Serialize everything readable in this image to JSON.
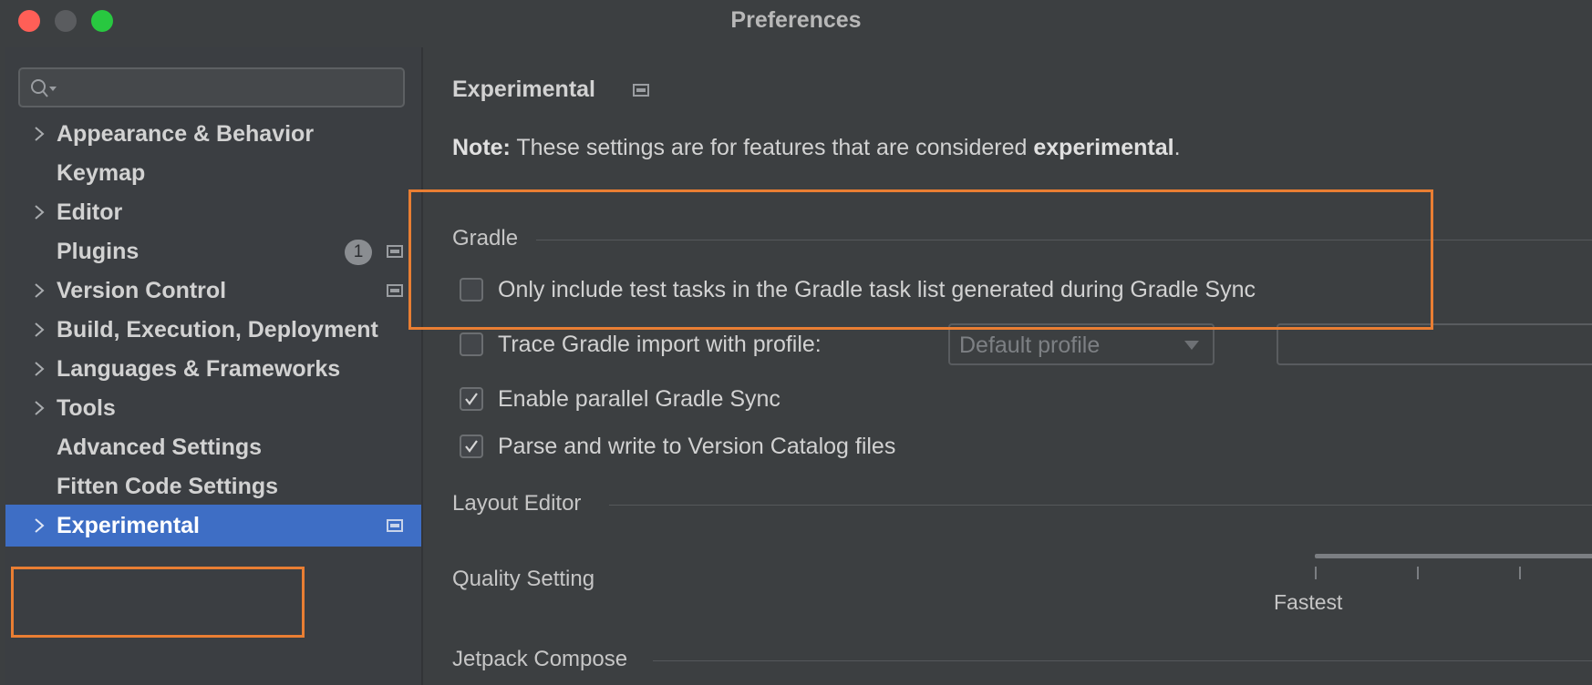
{
  "window": {
    "title": "Preferences"
  },
  "search": {
    "placeholder": ""
  },
  "sidebar": {
    "items": [
      {
        "label": "Appearance & Behavior",
        "expandable": true
      },
      {
        "label": "Keymap",
        "expandable": false
      },
      {
        "label": "Editor",
        "expandable": true
      },
      {
        "label": "Plugins",
        "expandable": false,
        "badge": "1"
      },
      {
        "label": "Version Control",
        "expandable": true
      },
      {
        "label": "Build, Execution, Deployment",
        "expandable": true
      },
      {
        "label": "Languages & Frameworks",
        "expandable": true
      },
      {
        "label": "Tools",
        "expandable": true
      },
      {
        "label": "Advanced Settings",
        "expandable": false
      },
      {
        "label": "Fitten Code Settings",
        "expandable": false
      },
      {
        "label": "Experimental",
        "expandable": true,
        "selected": true
      }
    ]
  },
  "main": {
    "title": "Experimental",
    "note_prefix": "Note:",
    "note_text": " These settings are for features that are considered ",
    "note_bold": "experimental",
    "note_suffix": ".",
    "gradle": {
      "header": "Gradle",
      "options": [
        {
          "label": "Only include test tasks in the Gradle task list generated during Gradle Sync",
          "checked": false
        },
        {
          "label": "Trace Gradle import with profile:",
          "checked": false
        },
        {
          "label": "Enable parallel Gradle Sync",
          "checked": true
        },
        {
          "label": "Parse and write to Version Catalog files",
          "checked": true
        }
      ],
      "profile_dropdown": {
        "value": "Default profile"
      }
    },
    "layout_editor": {
      "header": "Layout Editor",
      "quality_label": "Quality Setting",
      "slider_label": "Fastest"
    },
    "compose": {
      "header": "Jetpack Compose"
    }
  },
  "colors": {
    "selection": "#3e6ec5",
    "highlight": "#e97e33",
    "close": "#ff5f57",
    "maximize": "#28c840"
  }
}
